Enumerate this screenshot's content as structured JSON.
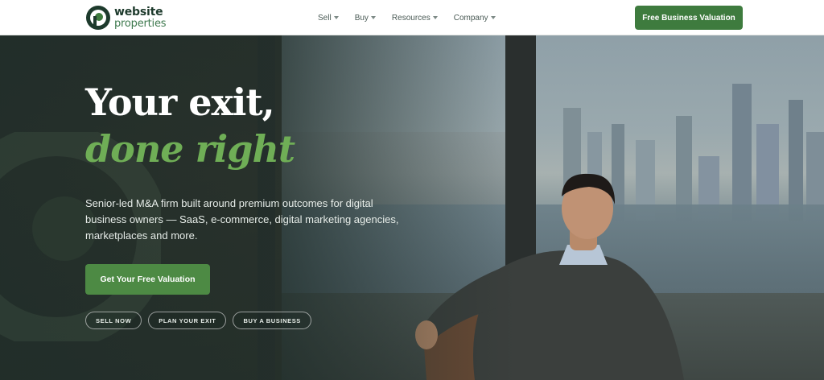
{
  "header": {
    "logo_line1": "website",
    "logo_line2": "properties",
    "nav": [
      {
        "label": "Sell"
      },
      {
        "label": "Buy"
      },
      {
        "label": "Resources"
      },
      {
        "label": "Company"
      }
    ],
    "cta_label": "Free Business Valuation"
  },
  "hero": {
    "headline_line1": "Your exit,",
    "headline_line2": "done right",
    "subtext": "Senior-led M&A firm built around premium outcomes for digital business owners — SaaS, e-commerce, digital marketing agencies, marketplaces and more.",
    "cta_label": "Get Your Free Valuation",
    "pills": [
      {
        "label": "SELL NOW"
      },
      {
        "label": "PLAN YOUR EXIT"
      },
      {
        "label": "BUY A BUSINESS"
      }
    ]
  },
  "colors": {
    "brand_green": "#3e7b3e",
    "accent_green": "#6fae56",
    "dark_green": "#1d3a2c"
  },
  "icons": {
    "logo": "logo-mark-icon",
    "nav_caret": "chevron-down-icon"
  }
}
